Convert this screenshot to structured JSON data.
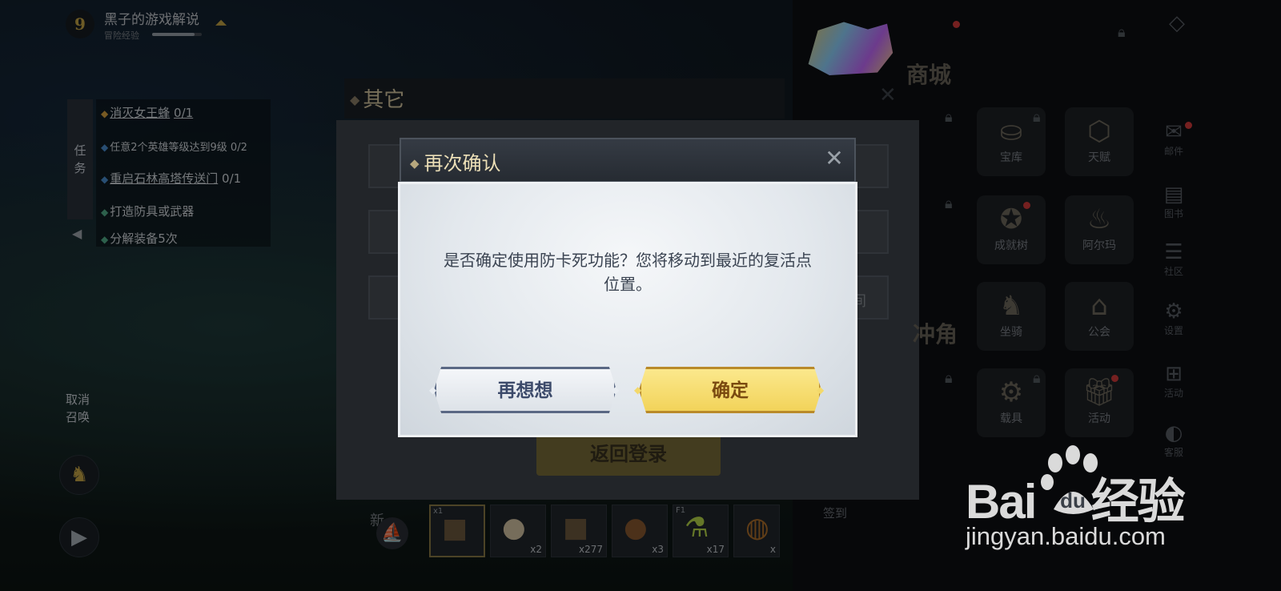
{
  "player": {
    "level": "9",
    "name": "黑子的游戏解说",
    "exp_label": "冒险经验",
    "exp_fraction": 0.85
  },
  "quests": {
    "tab_label_1": "任",
    "tab_label_2": "务",
    "items": [
      {
        "text": "消灭女王蜂",
        "progress": "0/1"
      },
      {
        "text": "任意2个英雄等级达到9级",
        "progress": "0/2"
      },
      {
        "text": "重启石林高塔传送门",
        "progress": "0/1"
      },
      {
        "text": "打造防具或武器",
        "progress": ""
      },
      {
        "text": "分解装备5次",
        "progress": ""
      }
    ]
  },
  "left_controls": {
    "cancel_summon_1": "取消",
    "cancel_summon_2": "召唤"
  },
  "menu": {
    "title": "其它",
    "row_suffix": "间",
    "return_login": "返回登录"
  },
  "right_panel": {
    "shop": "商城",
    "hero_label": "冲角",
    "tiles": [
      {
        "label": "天赋",
        "icon": "talent-icon"
      },
      {
        "label": "宝库",
        "icon": "treasury-icon"
      },
      {
        "label": "成就树",
        "icon": "achievement-tree-icon"
      },
      {
        "label": "阿尔玛",
        "icon": "alma-icon"
      },
      {
        "label": "坐骑",
        "icon": "mount-icon"
      },
      {
        "label": "公会",
        "icon": "guild-icon"
      },
      {
        "label": "载具",
        "icon": "vehicle-icon"
      },
      {
        "label": "活动",
        "icon": "event-gift-icon"
      }
    ],
    "side": [
      {
        "label": "邮件",
        "icon": "mail-icon"
      },
      {
        "label": "图书",
        "icon": "book-icon"
      },
      {
        "label": "社区",
        "icon": "community-icon"
      },
      {
        "label": "设置",
        "icon": "settings-icon"
      },
      {
        "label": "活动",
        "icon": "activity-icon"
      },
      {
        "label": "客服",
        "icon": "support-icon"
      }
    ],
    "signin": "签到"
  },
  "hotbar": {
    "label": "新",
    "slots": [
      {
        "tag": "x1",
        "count": "",
        "icon": "crate-icon"
      },
      {
        "tag": "",
        "count": "x2",
        "icon": "egg-icon"
      },
      {
        "tag": "",
        "count": "x277",
        "icon": "crate-icon"
      },
      {
        "tag": "",
        "count": "x3",
        "icon": "coconut-icon"
      },
      {
        "tag": "F1",
        "count": "x17",
        "icon": "potion-icon"
      },
      {
        "tag": "",
        "count": "x",
        "icon": "item-icon"
      }
    ]
  },
  "dialog": {
    "title": "再次确认",
    "message_line1": "是否确定使用防卡死功能？您将移动到最近的复活点",
    "message_line2": "位置。",
    "cancel_label": "再想想",
    "confirm_label": "确定"
  },
  "watermark": {
    "brand": "Bai",
    "brand2": "du",
    "suffix": "经验",
    "url": "jingyan.baidu.com"
  }
}
